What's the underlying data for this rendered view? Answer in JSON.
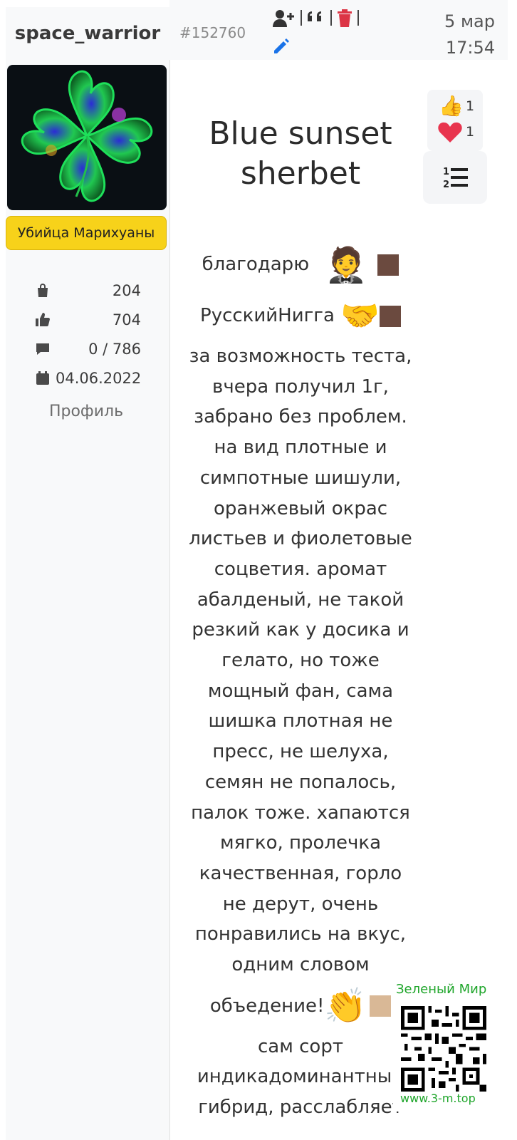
{
  "user": {
    "username": "space_warrior",
    "role": "Убийца Марихуаны",
    "stats": {
      "orders": "204",
      "likes": "704",
      "comments": "0 / 786",
      "registered": "04.06.2022"
    },
    "profile_link": "Профиль"
  },
  "post": {
    "id": "#152760",
    "date": "5 мар",
    "time": "17:54",
    "title_line1": "Blue sunset",
    "title_line2": "sherbet",
    "reactions": {
      "thumbs_up_count": "1",
      "heart_count": "1"
    },
    "body_lines": [
      "благодарю",
      "РусскийНигга",
      "за возможность теста,",
      "вчера получил 1г,",
      "забрано без проблем.",
      "на вид плотные и",
      "симпотные шишули,",
      "оранжевый окрас",
      "листьев и фиолетовые",
      "соцветия. аромат",
      "абалденый, не такой",
      "резкий как у досика и",
      "гелато, но тоже",
      "мощный фан, сама",
      "шишка плотная не",
      "пресс, не шелуха,",
      "семян не попалось,",
      "палок тоже. хапаются",
      "мягко, пролечка",
      "качественная, горло",
      "не дерут, очень",
      "понравились на вкус,",
      "одним словом",
      "объедение!",
      "сам сорт",
      "индикадоминантный",
      "гибрид, расслабляет"
    ]
  },
  "watermark": {
    "title": "Зеленый Мир",
    "url": "www.3-m.top"
  },
  "icons": {
    "add_user": "user-plus-icon",
    "quote": "quote-icon",
    "delete": "trash-icon",
    "edit": "pencil-icon",
    "toc": "ordered-list-icon"
  },
  "colors": {
    "badge": "#f7d21a",
    "trash": "#dc3545",
    "edit": "#1a73e8",
    "brown_square": "#6b4a3f",
    "watermark_green": "#1ea52a"
  }
}
